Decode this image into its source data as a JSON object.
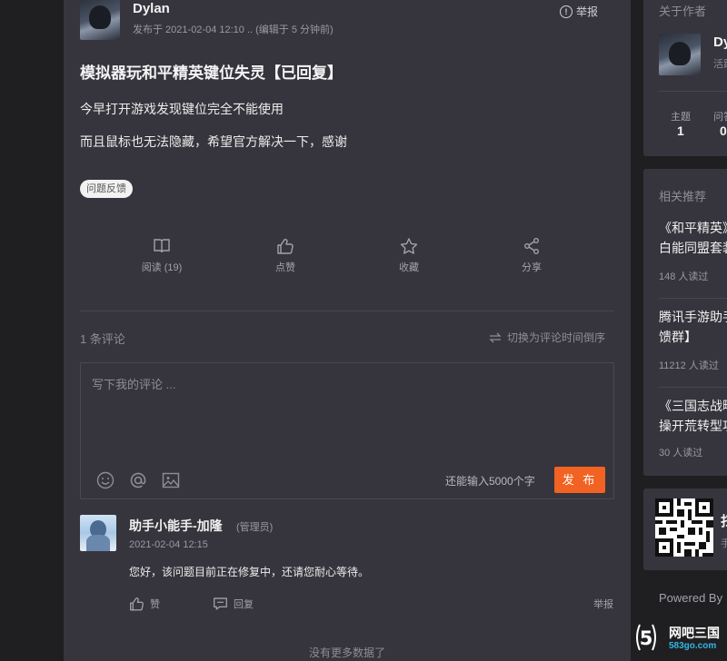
{
  "post": {
    "author": "Dylan",
    "meta": "发布于 2021-02-04 12:10 .. (编辑于 5 分钟前)",
    "report": "举报",
    "title": "模拟器玩和平精英键位失灵【已回复】",
    "paragraphs": [
      "今早打开游戏发现键位完全不能使用",
      "而且鼠标也无法隐藏，希望官方解决一下，感谢"
    ],
    "tag": "问题反馈"
  },
  "actions": {
    "read": "阅读 (19)",
    "like": "点赞",
    "favorite": "收藏",
    "share": "分享"
  },
  "comments": {
    "count": "1 条评论",
    "sort_toggle": "切换为评论时间倒序",
    "placeholder": "写下我的评论 ...",
    "remaining": "还能输入5000个字",
    "publish": "发 布",
    "no_more": "没有更多数据了"
  },
  "reply": {
    "name": "助手小能手-加隆",
    "role": "(管理员)",
    "time": "2021-02-04 12:15",
    "text": "您好，该问题目前正在修复中，还请您耐心等待。",
    "like": "赞",
    "reply": "回复",
    "report": "举报"
  },
  "sidebar": {
    "about_title": "关于作者",
    "author_name": "Dy",
    "author_sub": "活跃",
    "stats": [
      {
        "label": "主题",
        "value": "1"
      },
      {
        "label": "问答",
        "value": "0"
      }
    ],
    "related_title": "相关推荐",
    "related": [
      {
        "line1": "《和平精英》",
        "line2": "白能同盟套装",
        "reads": "148 人读过"
      },
      {
        "line1": "腾讯手游助手",
        "line2": "馈群】",
        "reads": "11212 人读过"
      },
      {
        "line1": "《三国志战略",
        "line2": "操开荒转型攻",
        "reads": "30 人读过"
      }
    ],
    "qr_title": "扫",
    "qr_sub": "手",
    "powered": "Powered By"
  },
  "watermark": {
    "logo_glyph": "5",
    "name": "网吧三国",
    "url": "583go.com"
  }
}
